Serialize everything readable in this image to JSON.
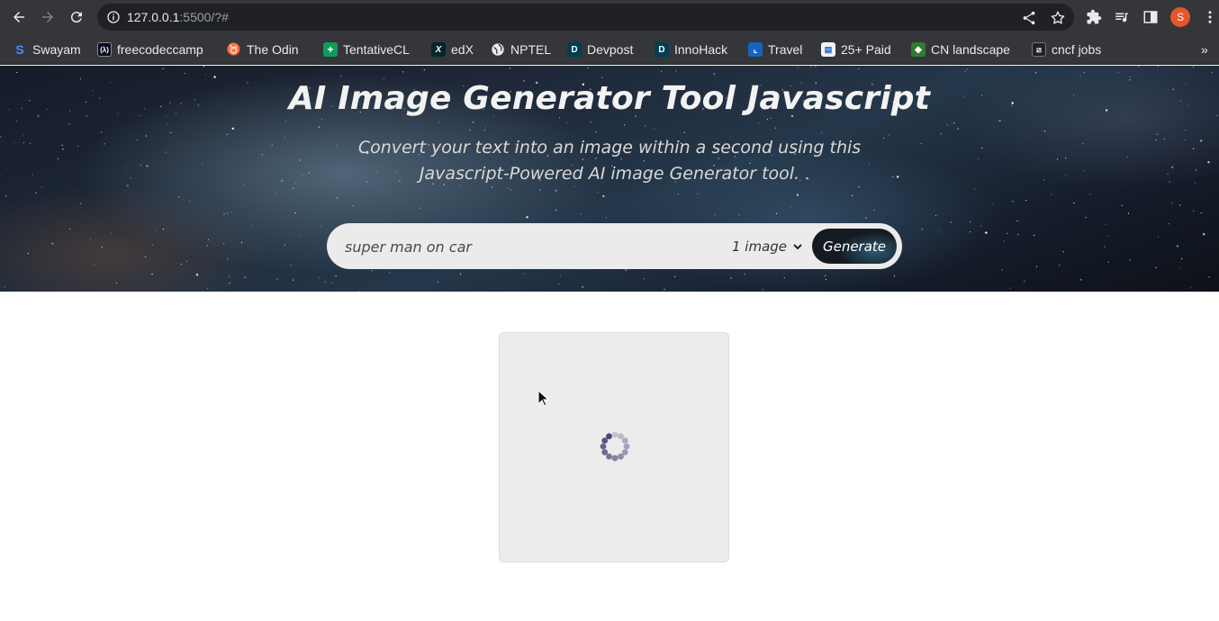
{
  "browser": {
    "url_host": "127.0.0.1",
    "url_rest": ":5500/?#",
    "profile_initial": "S",
    "bookmarks": [
      {
        "label": "Swayam",
        "icon": "swayam-icon",
        "color": "#1a73e8"
      },
      {
        "label": "freecodeccamp",
        "icon": "freecodecamp-icon",
        "color": "#0a0a23"
      },
      {
        "label": "The Odin",
        "icon": "odin-icon",
        "color": "#c9a469"
      },
      {
        "label": "TentativeCL",
        "icon": "sheets-icon",
        "color": "#0f9d58"
      },
      {
        "label": "edX",
        "icon": "edx-icon",
        "color": "#02262b"
      },
      {
        "label": "NPTEL",
        "icon": "globe-icon",
        "color": "#5f6368"
      },
      {
        "label": "Devpost",
        "icon": "devpost-icon",
        "color": "#003e54"
      },
      {
        "label": "InnoHack",
        "icon": "devpost-icon",
        "color": "#003e54"
      },
      {
        "label": "Travel",
        "icon": "travel-icon",
        "color": "#1565c0"
      },
      {
        "label": "25+ Paid",
        "icon": "doc-icon",
        "color": "#e8eaed"
      },
      {
        "label": "CN landscape",
        "icon": "cncf-icon",
        "color": "#2e7d32"
      },
      {
        "label": "cncf jobs",
        "icon": "cncf-jobs-icon",
        "color": "#333333"
      }
    ]
  },
  "page": {
    "title": "AI Image Generator Tool Javascript",
    "subtitle": "Convert your text into an image within a second using this Javascript-Powered AI image Generator tool.",
    "prompt_value": "super man on car",
    "image_count": "1 image",
    "generate_label": "Generate",
    "loading": true
  },
  "colors": {
    "chrome_bg": "#35363a",
    "omnibox_bg": "#202124",
    "search_bar_bg": "#ebebeb",
    "card_bg": "#ececec",
    "spinner": "#4a4a7a"
  }
}
